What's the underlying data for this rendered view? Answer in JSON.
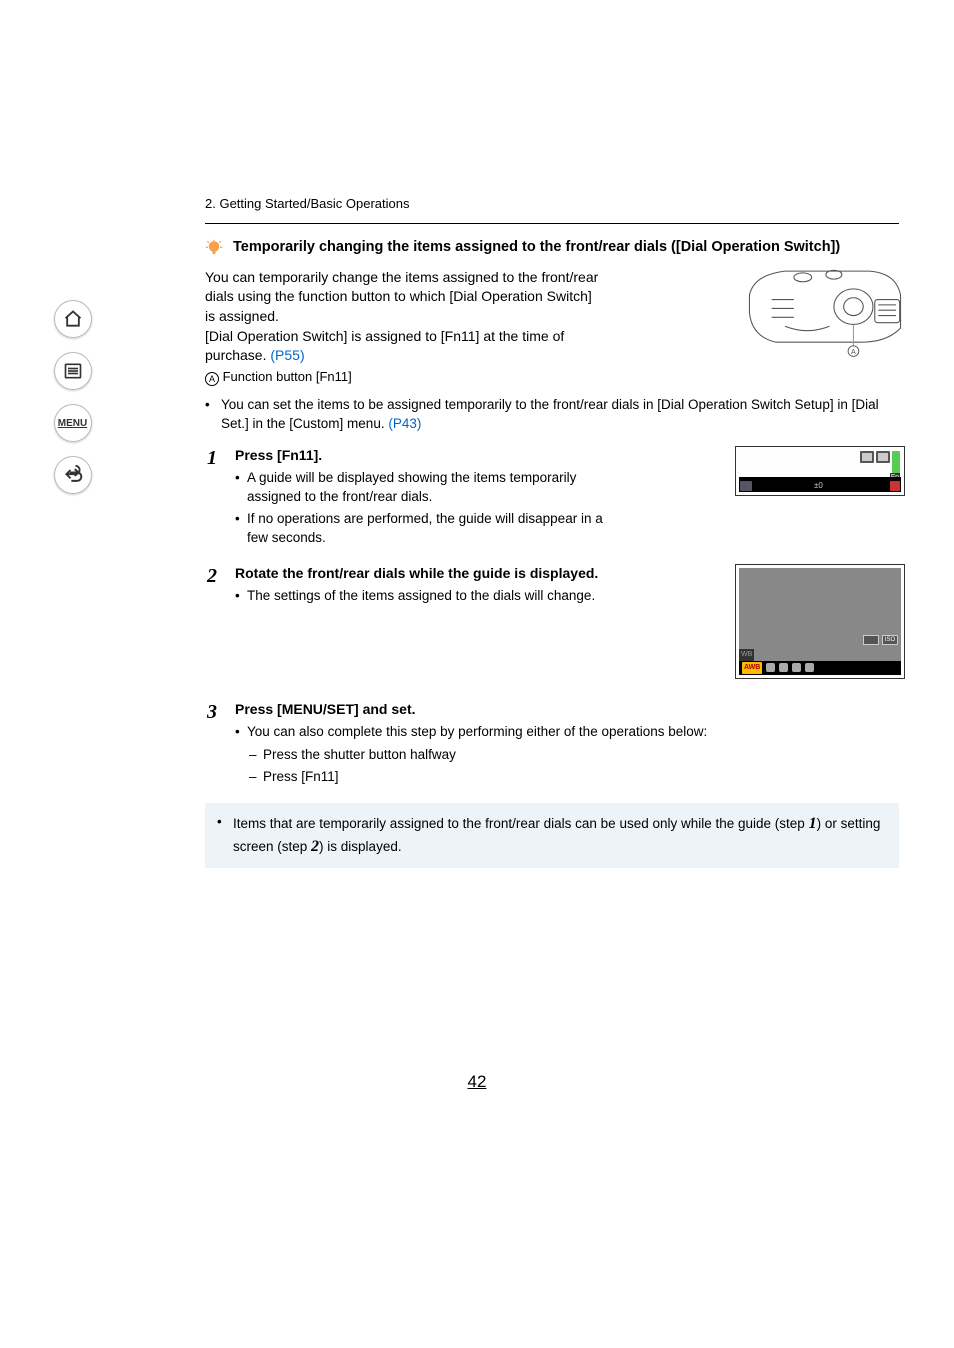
{
  "breadcrumb": "2. Getting Started/Basic Operations",
  "section_title": "Temporarily changing the items assigned to the front/rear dials ([Dial Operation Switch])",
  "intro": {
    "p1": "You can temporarily change the items assigned to the front/rear dials using the function button to which [Dial Operation Switch] is assigned.",
    "p2a": "[Dial Operation Switch] is assigned to [Fn11] at the time of purchase. ",
    "p2_link": "(P55)",
    "callout_label": "A",
    "callout_text": " Function button [Fn11]"
  },
  "note1": {
    "text_a": "You can set the items to be assigned temporarily to the front/rear dials in [Dial Operation Switch Setup] in [Dial Set.] in the [Custom] menu. ",
    "link": "(P43)"
  },
  "steps": [
    {
      "num": "1",
      "title": "Press [Fn11].",
      "bullets": [
        "A guide will be displayed showing the items temporarily assigned to the front/rear dials.",
        "If no operations are performed, the guide will disappear in a few seconds."
      ]
    },
    {
      "num": "2",
      "title": "Rotate the front/rear dials while the guide is displayed.",
      "bullets": [
        "The settings of the items assigned to the dials will change."
      ]
    },
    {
      "num": "3",
      "title": "Press [MENU/SET] and set.",
      "bullets_full": [
        "You can also complete this step by performing either of the operations below:"
      ],
      "sub": [
        "Press the shutter button halfway",
        "Press [Fn11]"
      ]
    }
  ],
  "screen1": {
    "ev": "±0",
    "fn": "Fn",
    "iso_hint": "ISO"
  },
  "screen2": {
    "awb": "AWB",
    "wb": "WB",
    "iso": "ISO"
  },
  "final_note": {
    "a": "Items that are temporarily assigned to the front/rear dials can be used only while the guide (step ",
    "s1": "1",
    "b": ") or setting screen (step ",
    "s2": "2",
    "c": ") is displayed."
  },
  "page_number": "42",
  "sidebar": {
    "menu": "MENU"
  }
}
